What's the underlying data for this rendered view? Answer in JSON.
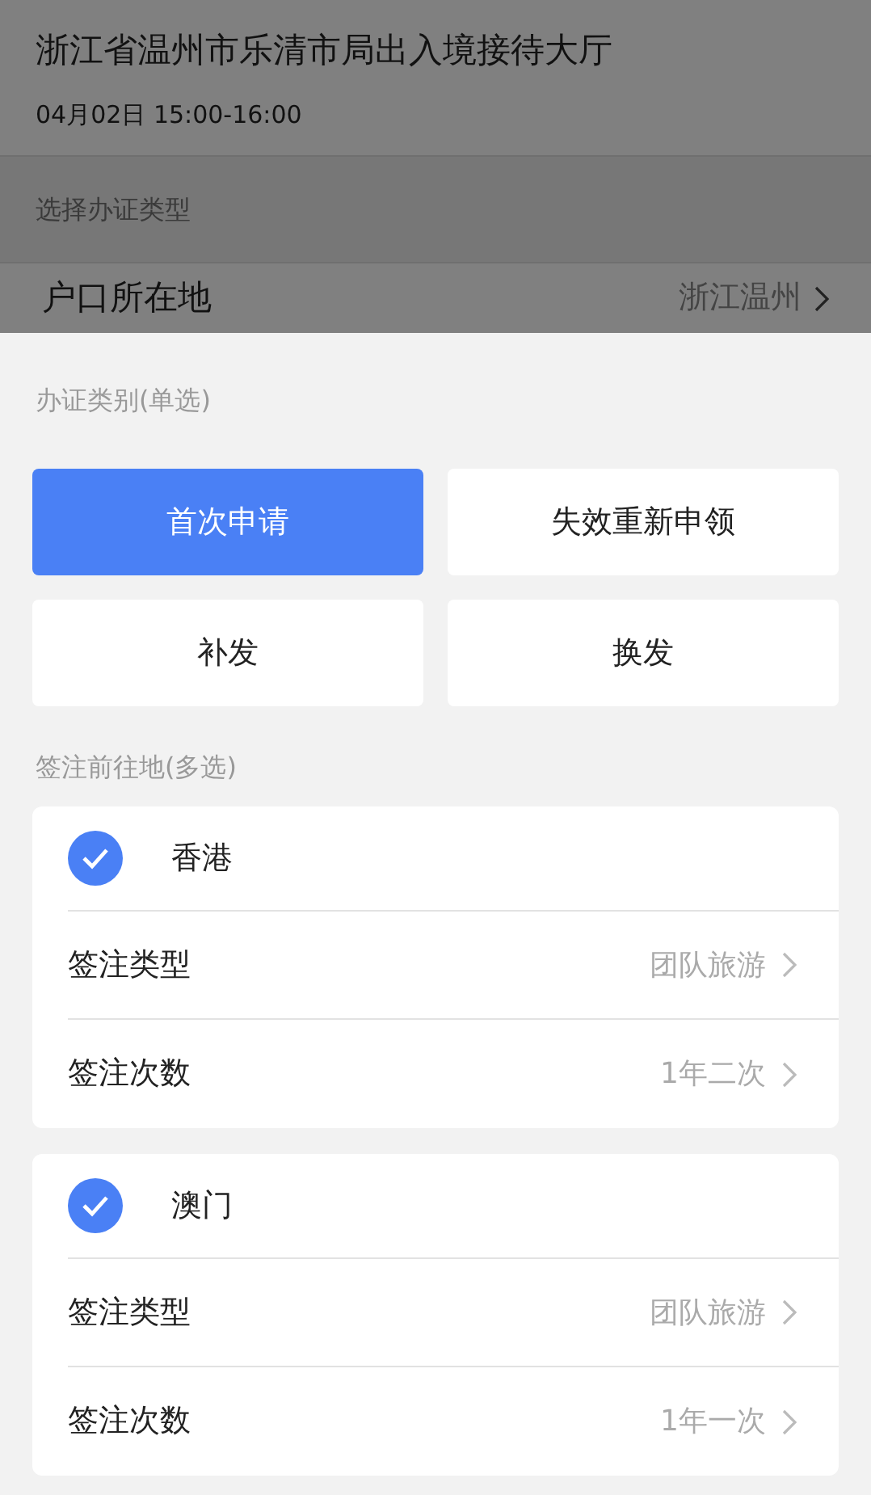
{
  "header": {
    "title": "浙江省温州市乐清市局出入境接待大厅",
    "time": "04月02日 15:00-16:00"
  },
  "section_label": "选择办证类型",
  "residence": {
    "label": "户口所在地",
    "value": "浙江温州"
  },
  "sheet": {
    "type_label": "办证类别(单选)",
    "types": [
      {
        "label": "首次申请",
        "selected": true
      },
      {
        "label": "失效重新申领",
        "selected": false
      },
      {
        "label": "补发",
        "selected": false
      },
      {
        "label": "换发",
        "selected": false
      }
    ],
    "destination_label": "签注前往地(多选)",
    "destinations": [
      {
        "name": "香港",
        "checked": true,
        "rows": [
          {
            "label": "签注类型",
            "value": "团队旅游"
          },
          {
            "label": "签注次数",
            "value": "1年二次"
          }
        ]
      },
      {
        "name": "澳门",
        "checked": true,
        "rows": [
          {
            "label": "签注类型",
            "value": "团队旅游"
          },
          {
            "label": "签注次数",
            "value": "1年一次"
          }
        ]
      }
    ]
  }
}
